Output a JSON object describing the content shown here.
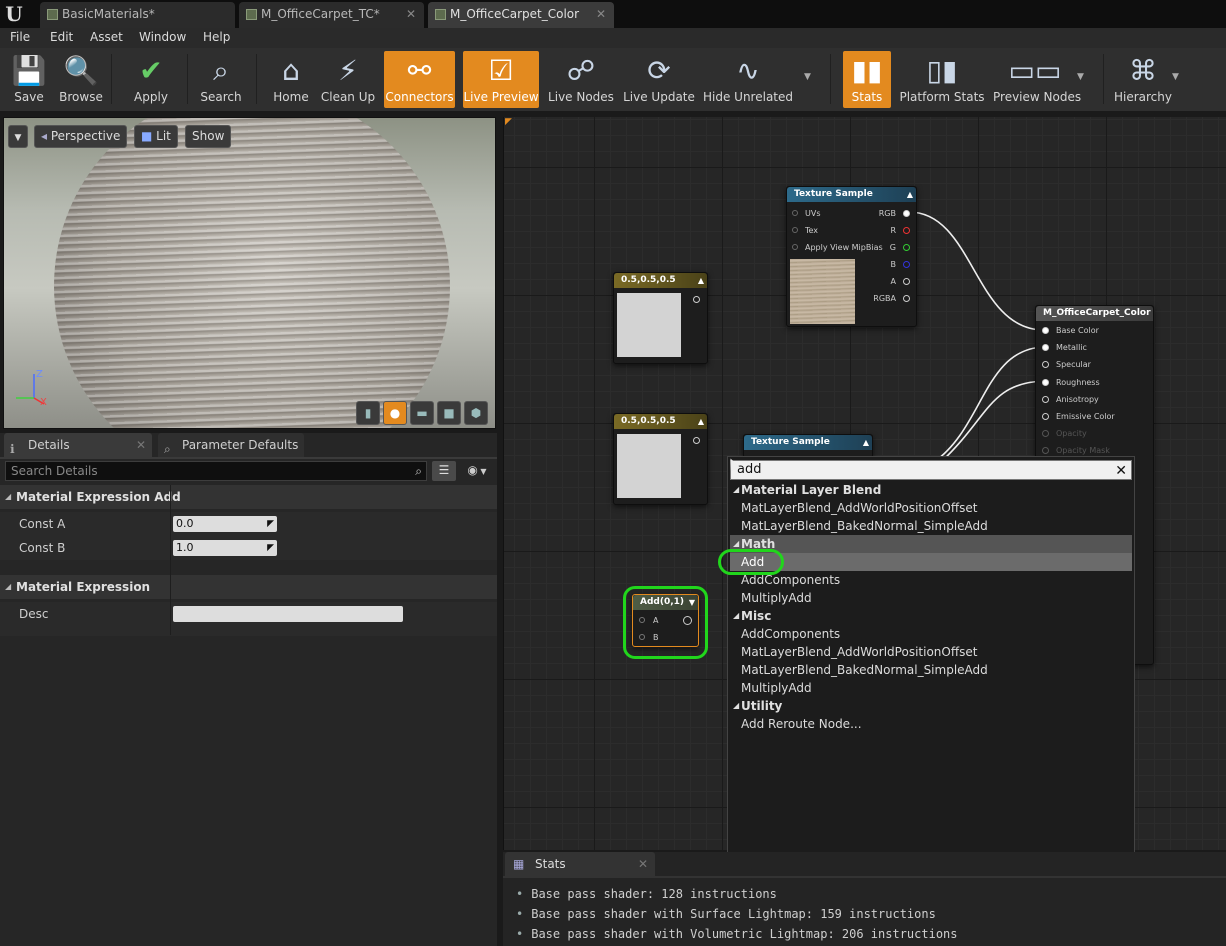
{
  "tabs": [
    {
      "label": "BasicMaterials*"
    },
    {
      "label": "M_OfficeCarpet_TC*"
    },
    {
      "label": "M_OfficeCarpet_Color"
    }
  ],
  "menu": [
    "File",
    "Edit",
    "Asset",
    "Window",
    "Help"
  ],
  "toolbar": {
    "save": "Save",
    "browse": "Browse",
    "apply": "Apply",
    "search": "Search",
    "home": "Home",
    "clean_up": "Clean Up",
    "connectors": "Connectors",
    "live_preview": "Live Preview",
    "live_nodes": "Live Nodes",
    "live_update": "Live Update",
    "hide_unrelated": "Hide Unrelated",
    "stats": "Stats",
    "platform_stats": "Platform Stats",
    "preview_nodes": "Preview Nodes",
    "hierarchy": "Hierarchy"
  },
  "viewport": {
    "perspective": "Perspective",
    "lit": "Lit",
    "show": "Show",
    "axis_z": "Z",
    "axis_x": "X"
  },
  "details": {
    "tab_details": "Details",
    "tab_params": "Parameter Defaults",
    "search_placeholder": "Search Details",
    "cat_add": "Material Expression Add",
    "const_a_label": "Const A",
    "const_a_value": "0.0",
    "const_b_label": "Const B",
    "const_b_value": "1.0",
    "cat_expr": "Material Expression",
    "desc_label": "Desc"
  },
  "graph": {
    "const1_title": "0.5,0.5,0.5",
    "const2_title": "0.5,0.5,0.5",
    "tex1_title": "Texture Sample",
    "tex1_pins_in": [
      "UVs",
      "Tex",
      "Apply View MipBias"
    ],
    "tex1_pins_out": [
      "RGB",
      "R",
      "G",
      "B",
      "A",
      "RGBA"
    ],
    "tex2_title": "Texture Sample",
    "output_title": "M_OfficeCarpet_Color",
    "output_pins": [
      "Base Color",
      "Metallic",
      "Specular",
      "Roughness",
      "Anisotropy",
      "Emissive Color",
      "Opacity",
      "Opacity Mask"
    ],
    "add_title": "Add(0,1)",
    "add_pins": [
      "A",
      "B"
    ]
  },
  "context_menu": {
    "search_value": "add",
    "sections": [
      {
        "category": "Material Layer Blend",
        "items": [
          "MatLayerBlend_AddWorldPositionOffset",
          "MatLayerBlend_BakedNormal_SimpleAdd"
        ]
      },
      {
        "category": "Math",
        "items": [
          "Add",
          "AddComponents",
          "MultiplyAdd"
        ]
      },
      {
        "category": "Misc",
        "items": [
          "AddComponents",
          "MatLayerBlend_AddWorldPositionOffset",
          "MatLayerBlend_BakedNormal_SimpleAdd",
          "MultiplyAdd"
        ]
      },
      {
        "category": "Utility",
        "items": [
          "Add Reroute Node..."
        ]
      }
    ],
    "selected_item": "Add"
  },
  "stats": {
    "tab": "Stats",
    "lines": [
      "Base pass shader: 128 instructions",
      "Base pass shader with Surface Lightmap: 159 instructions",
      "Base pass shader with Volumetric Lightmap: 206 instructions"
    ]
  },
  "colors": {
    "accent_orange": "#e38a1f",
    "highlight_green": "#21d61c"
  }
}
